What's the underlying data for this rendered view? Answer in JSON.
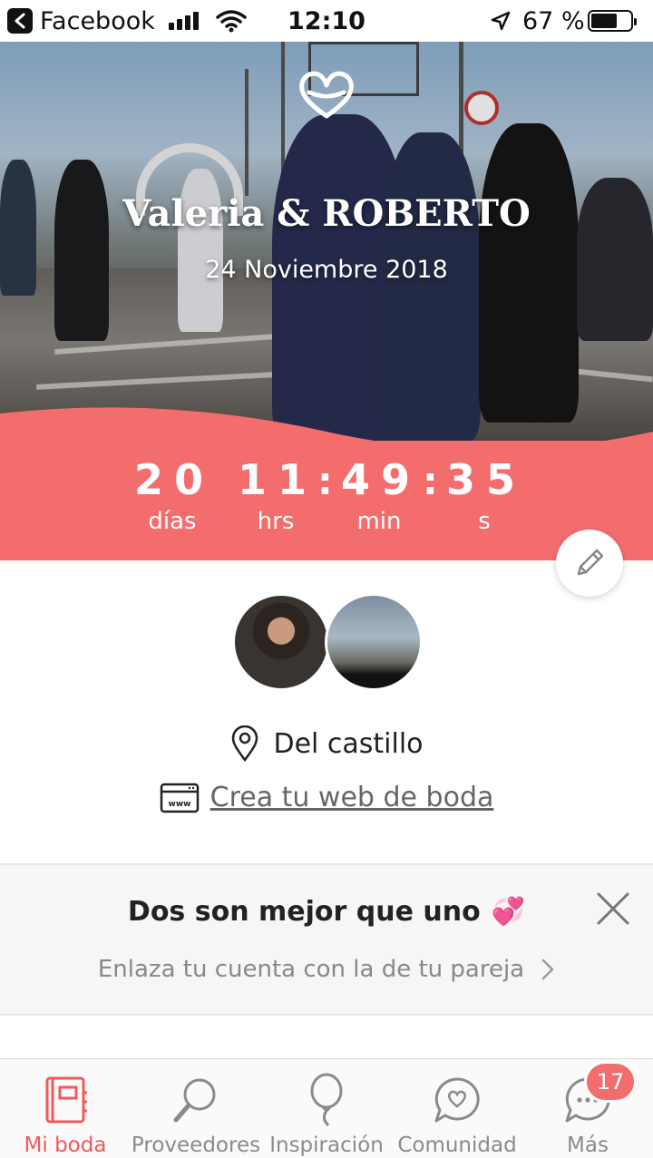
{
  "status_bar": {
    "back_app": "Facebook",
    "time": "12:10",
    "battery_percent": "67 %",
    "battery_level": 0.67
  },
  "hero": {
    "title": "Valeria & ROBERTO",
    "date": "24 Noviembre 2018",
    "logo_icon": "heart-icon"
  },
  "countdown": {
    "days": "20",
    "days_label": "días",
    "hours": "11",
    "hours_label": "hrs",
    "minutes": "49",
    "minutes_label": "min",
    "seconds": "35",
    "seconds_label": "s",
    "separator": ":"
  },
  "profile": {
    "location": "Del castillo",
    "web_link": "Crea tu web de boda"
  },
  "banner": {
    "title": "Dos son mejor que uno",
    "title_emoji": "💞",
    "subtitle": "Enlaza tu cuenta con la de tu pareja",
    "chevron": "›"
  },
  "tabs": [
    {
      "label": "Mi boda",
      "icon": "notebook-icon",
      "active": true
    },
    {
      "label": "Proveedores",
      "icon": "magnifier-icon",
      "active": false
    },
    {
      "label": "Inspiración",
      "icon": "balloon-icon",
      "active": false
    },
    {
      "label": "Comunidad",
      "icon": "chat-heart-icon",
      "active": false
    },
    {
      "label": "Más",
      "icon": "more-dots-icon",
      "active": false
    }
  ],
  "more_badge": "17",
  "colors": {
    "accent": "#f46d6d",
    "tab_active": "#f05a5a",
    "tab_inactive": "#8a8a8a"
  }
}
